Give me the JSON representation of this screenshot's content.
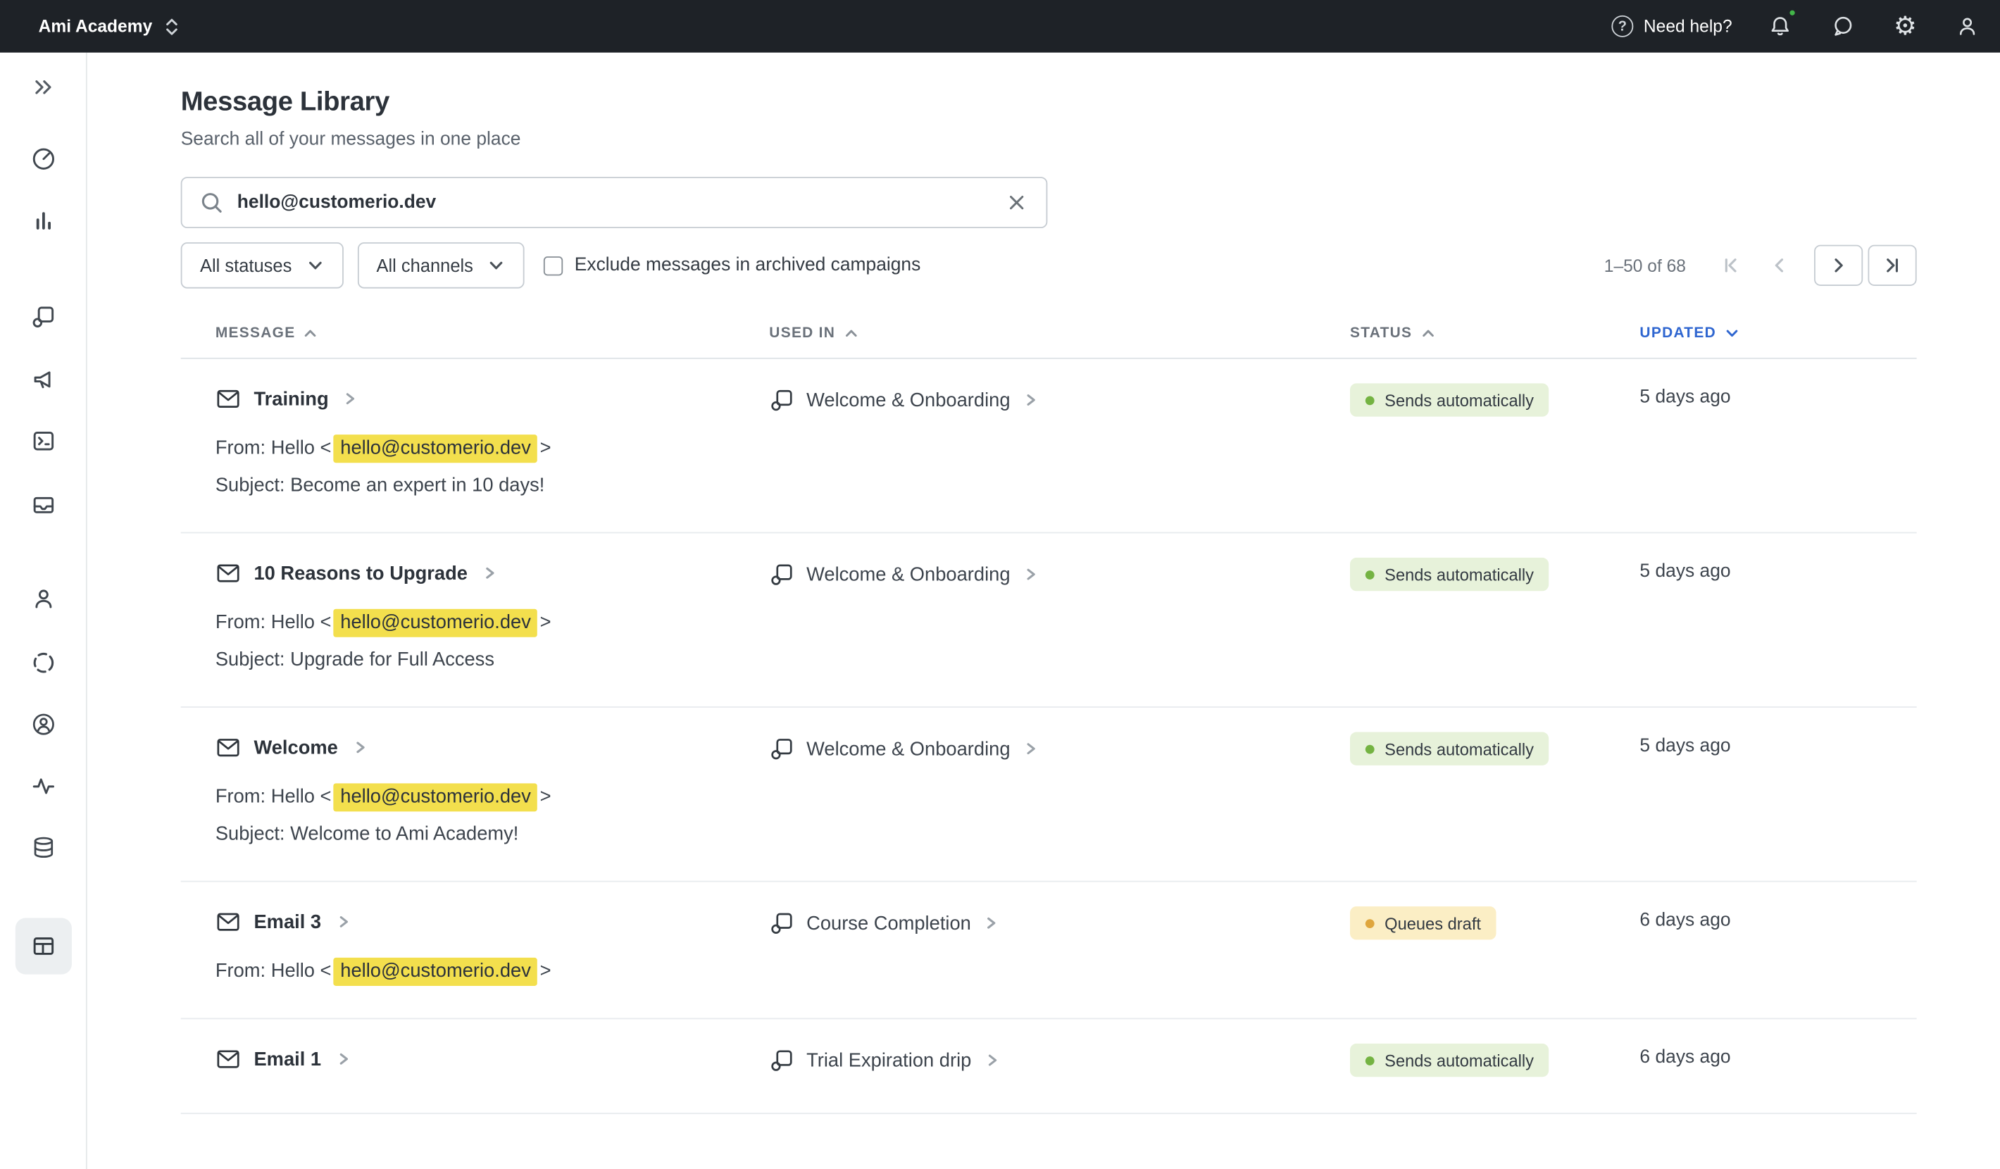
{
  "topbar": {
    "workspace": "Ami Academy",
    "help": "Need help?"
  },
  "icons": {
    "help_glyph": "?",
    "gear_glyph": "⚙"
  },
  "page": {
    "title": "Message Library",
    "subtitle": "Search all of your messages in one place"
  },
  "search": {
    "value": "hello@customerio.dev"
  },
  "filters": {
    "statuses_label": "All statuses",
    "channels_label": "All channels",
    "archived_label": "Exclude messages in archived campaigns",
    "archived_checked": false
  },
  "pagination": {
    "range": "1–50 of 68"
  },
  "colors": {
    "topbar_bg": "#1e2227",
    "accent_blue": "#2f66d0",
    "highlight_yellow": "#f3df4d",
    "status_green_bg": "#e7f2da",
    "status_green_dot": "#74b342",
    "status_yellow_bg": "#fbeec5",
    "status_yellow_dot": "#dfa63d",
    "notification_green": "#43b649"
  },
  "table": {
    "headers": {
      "message": "MESSAGE",
      "used_in": "USED IN",
      "status": "STATUS",
      "updated": "UPDATED"
    },
    "rows": [
      {
        "title": "Training",
        "used_in": "Welcome & Onboarding",
        "status": "Sends automatically",
        "status_type": "green",
        "updated": "5 days ago",
        "from_prefix": "From: Hello <",
        "from_highlight": "hello@customerio.dev",
        "from_suffix": ">",
        "subject": "Subject: Become an expert in 10 days!"
      },
      {
        "title": "10 Reasons to Upgrade",
        "used_in": "Welcome & Onboarding",
        "status": "Sends automatically",
        "status_type": "green",
        "updated": "5 days ago",
        "from_prefix": "From: Hello <",
        "from_highlight": "hello@customerio.dev",
        "from_suffix": ">",
        "subject": "Subject: Upgrade for Full Access"
      },
      {
        "title": "Welcome",
        "used_in": "Welcome & Onboarding",
        "status": "Sends automatically",
        "status_type": "green",
        "updated": "5 days ago",
        "from_prefix": "From: Hello <",
        "from_highlight": "hello@customerio.dev",
        "from_suffix": ">",
        "subject": "Subject: Welcome to Ami Academy!"
      },
      {
        "title": "Email 3",
        "used_in": "Course Completion",
        "status": "Queues draft",
        "status_type": "yellow",
        "updated": "6 days ago",
        "from_prefix": "From: Hello <",
        "from_highlight": "hello@customerio.dev",
        "from_suffix": ">",
        "subject": null
      },
      {
        "title": "Email 1",
        "used_in": "Trial Expiration drip",
        "status": "Sends automatically",
        "status_type": "green",
        "updated": "6 days ago",
        "from_prefix": null,
        "from_highlight": null,
        "from_suffix": null,
        "subject": null
      }
    ]
  }
}
